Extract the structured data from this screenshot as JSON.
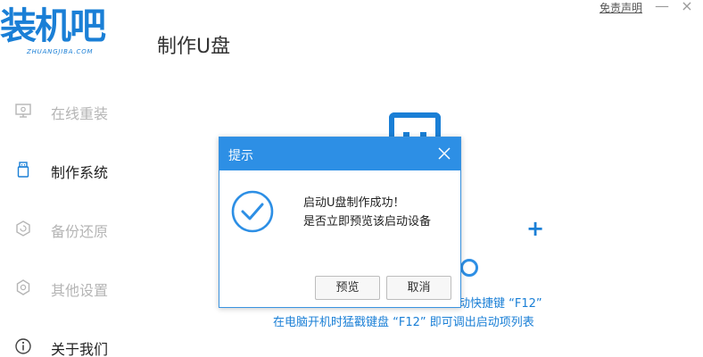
{
  "brand": {
    "logo_text": "装机吧",
    "logo_sub": "ZHUANGJIBA.COM",
    "accent": "#1a7fd6"
  },
  "header": {
    "title": "制作U盘",
    "disclaimer": "免责声明",
    "minimize": "—",
    "close": "×"
  },
  "sidebar": {
    "items": [
      {
        "label": "在线重装",
        "icon": "monitor-icon",
        "active": false
      },
      {
        "label": "制作系统",
        "icon": "usb-drive-icon",
        "active": true
      },
      {
        "label": "备份还原",
        "icon": "backup-icon",
        "active": false
      },
      {
        "label": "其他设置",
        "icon": "gear-icon",
        "active": false
      },
      {
        "label": "关于我们",
        "icon": "info-icon",
        "active": false
      }
    ]
  },
  "background": {
    "hint1": "动快捷键 “F12”",
    "hint2": "在电脑开机时猛戳键盘 “F12” 即可调出启动项列表"
  },
  "dialog": {
    "title": "提示",
    "message_line1": "启动U盘制作成功！",
    "message_line2": "是否立即预览该启动设备",
    "preview_button": "预览",
    "cancel_button": "取消",
    "header_color": "#2d8fe5"
  }
}
